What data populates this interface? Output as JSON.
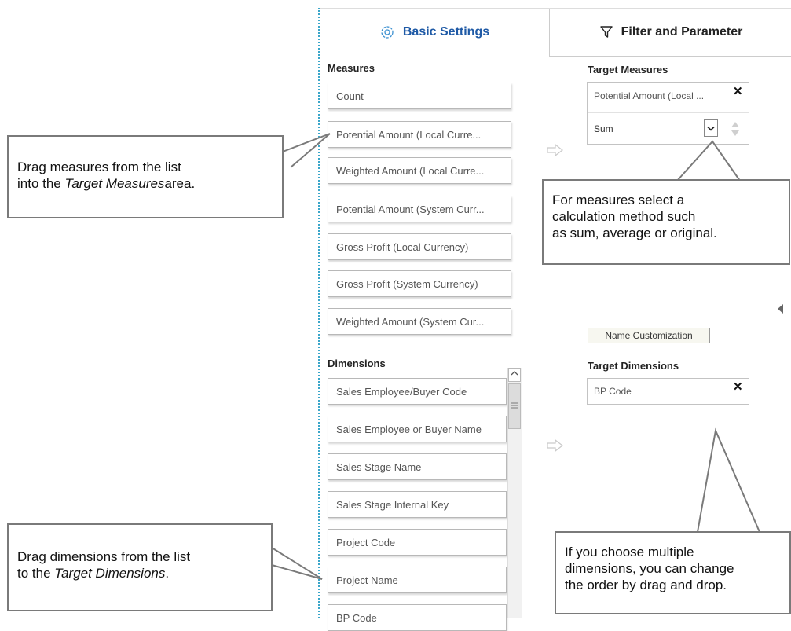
{
  "tabs": {
    "basic": "Basic Settings",
    "filter": "Filter and Parameter"
  },
  "measures": {
    "label": "Measures",
    "items": [
      "Count",
      "Potential Amount (Local Curre...",
      "Weighted Amount (Local Curre...",
      "Potential Amount (System Curr...",
      "Gross Profit (Local Currency)",
      "Gross Profit (System Currency)",
      "Weighted Amount (System Cur..."
    ]
  },
  "dimensions": {
    "label": "Dimensions",
    "items": [
      "Sales Employee/Buyer Code",
      "Sales Employee or Buyer Name",
      "Sales Stage Name",
      "Sales Stage Internal Key",
      "Project Code",
      "Project Name",
      "BP Code"
    ]
  },
  "target_measures": {
    "label": "Target Measures",
    "item": "Potential Amount (Local ...",
    "calc_method": "Sum"
  },
  "name_customization": "Name Customization",
  "target_dimensions": {
    "label": "Target Dimensions",
    "item": "BP Code"
  },
  "callouts": {
    "measures_line1": "Drag measures from the list",
    "measures_line2_pre": "into the ",
    "measures_line2_em": "Target Measures",
    "measures_line2_post": "area.",
    "calc_line1": "For measures select a",
    "calc_line2": "calculation method such",
    "calc_line3": "as sum, average or original.",
    "dims_line1": "Drag dimensions from the list",
    "dims_line2_pre": "to the ",
    "dims_line2_em": "Target Dimensions",
    "dims_line2_post": ".",
    "order_line1": "If you choose multiple",
    "order_line2": "dimensions, you can change",
    "order_line3": "the order by drag and drop."
  },
  "colors": {
    "accent": "#1f5aa6",
    "border": "#b8b8b8",
    "callout_border": "#7a7a7a"
  },
  "icons": [
    "gear-icon",
    "filter-icon",
    "arrow-right-icon",
    "close-icon",
    "chevron-down-icon",
    "sort-icon",
    "collapse-left-icon"
  ]
}
